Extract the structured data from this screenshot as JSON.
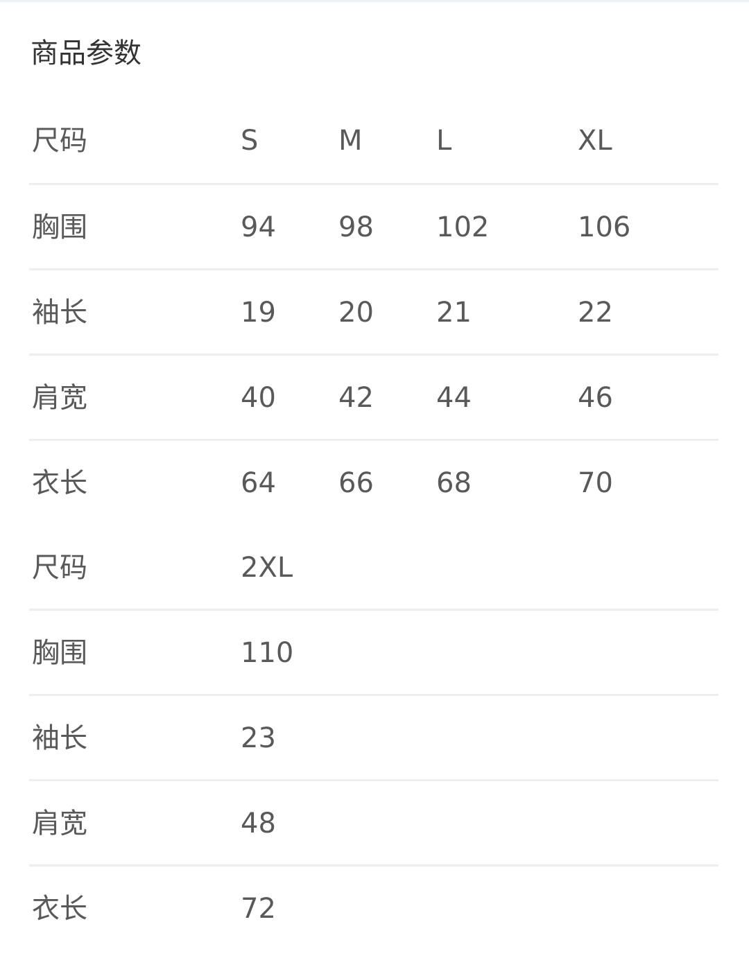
{
  "section": {
    "title": "商品参数"
  },
  "tables": [
    {
      "rows": [
        {
          "label": "尺码",
          "values": [
            "S",
            "M",
            "L",
            "XL"
          ]
        },
        {
          "label": "胸围",
          "values": [
            "94",
            "98",
            "102",
            "106"
          ]
        },
        {
          "label": "袖长",
          "values": [
            "19",
            "20",
            "21",
            "22"
          ]
        },
        {
          "label": "肩宽",
          "values": [
            "40",
            "42",
            "44",
            "46"
          ]
        },
        {
          "label": "衣长",
          "values": [
            "64",
            "66",
            "68",
            "70"
          ]
        }
      ]
    },
    {
      "rows": [
        {
          "label": "尺码",
          "values": [
            "2XL"
          ]
        },
        {
          "label": "胸围",
          "values": [
            "110"
          ]
        },
        {
          "label": "袖长",
          "values": [
            "23"
          ]
        },
        {
          "label": "肩宽",
          "values": [
            "48"
          ]
        },
        {
          "label": "衣长",
          "values": [
            "72"
          ]
        }
      ]
    }
  ],
  "colors": {
    "title_text": "#333333",
    "cell_text": "#595959",
    "divider": "#eeeeee",
    "top_border": "#eef2f4"
  }
}
